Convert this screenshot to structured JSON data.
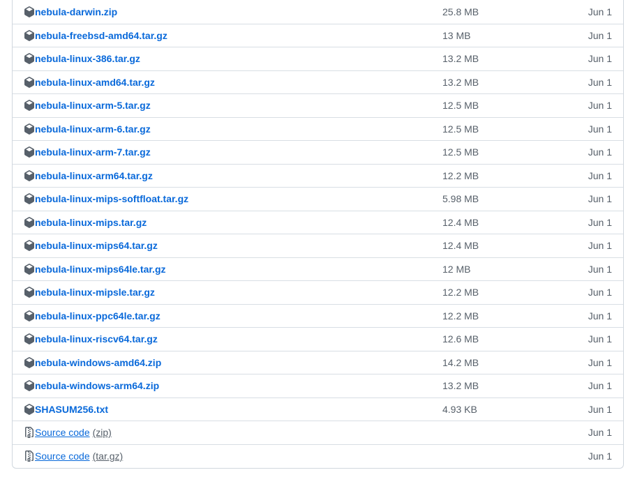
{
  "assets": [
    {
      "name": "nebula-darwin.zip",
      "size": "25.8 MB",
      "date": "Jun 1",
      "icon": "package-icon"
    },
    {
      "name": "nebula-freebsd-amd64.tar.gz",
      "size": "13 MB",
      "date": "Jun 1",
      "icon": "package-icon"
    },
    {
      "name": "nebula-linux-386.tar.gz",
      "size": "13.2 MB",
      "date": "Jun 1",
      "icon": "package-icon"
    },
    {
      "name": "nebula-linux-amd64.tar.gz",
      "size": "13.2 MB",
      "date": "Jun 1",
      "icon": "package-icon"
    },
    {
      "name": "nebula-linux-arm-5.tar.gz",
      "size": "12.5 MB",
      "date": "Jun 1",
      "icon": "package-icon"
    },
    {
      "name": "nebula-linux-arm-6.tar.gz",
      "size": "12.5 MB",
      "date": "Jun 1",
      "icon": "package-icon"
    },
    {
      "name": "nebula-linux-arm-7.tar.gz",
      "size": "12.5 MB",
      "date": "Jun 1",
      "icon": "package-icon"
    },
    {
      "name": "nebula-linux-arm64.tar.gz",
      "size": "12.2 MB",
      "date": "Jun 1",
      "icon": "package-icon"
    },
    {
      "name": "nebula-linux-mips-softfloat.tar.gz",
      "size": "5.98 MB",
      "date": "Jun 1",
      "icon": "package-icon"
    },
    {
      "name": "nebula-linux-mips.tar.gz",
      "size": "12.4 MB",
      "date": "Jun 1",
      "icon": "package-icon"
    },
    {
      "name": "nebula-linux-mips64.tar.gz",
      "size": "12.4 MB",
      "date": "Jun 1",
      "icon": "package-icon"
    },
    {
      "name": "nebula-linux-mips64le.tar.gz",
      "size": "12 MB",
      "date": "Jun 1",
      "icon": "package-icon"
    },
    {
      "name": "nebula-linux-mipsle.tar.gz",
      "size": "12.2 MB",
      "date": "Jun 1",
      "icon": "package-icon"
    },
    {
      "name": "nebula-linux-ppc64le.tar.gz",
      "size": "12.2 MB",
      "date": "Jun 1",
      "icon": "package-icon"
    },
    {
      "name": "nebula-linux-riscv64.tar.gz",
      "size": "12.6 MB",
      "date": "Jun 1",
      "icon": "package-icon"
    },
    {
      "name": "nebula-windows-amd64.zip",
      "size": "14.2 MB",
      "date": "Jun 1",
      "icon": "package-icon"
    },
    {
      "name": "nebula-windows-arm64.zip",
      "size": "13.2 MB",
      "date": "Jun 1",
      "icon": "package-icon"
    },
    {
      "name": "SHASUM256.txt",
      "size": "4.93 KB",
      "date": "Jun 1",
      "icon": "package-icon"
    }
  ],
  "source_code": [
    {
      "label": "Source code",
      "type": "(zip)",
      "date": "Jun 1",
      "icon": "file-zip-icon"
    },
    {
      "label": "Source code",
      "type": "(tar.gz)",
      "date": "Jun 1",
      "icon": "file-zip-icon"
    }
  ],
  "colors": {
    "link": "#0969da",
    "muted": "#57606a",
    "border": "#d0d7de",
    "icon": "#57606a"
  }
}
